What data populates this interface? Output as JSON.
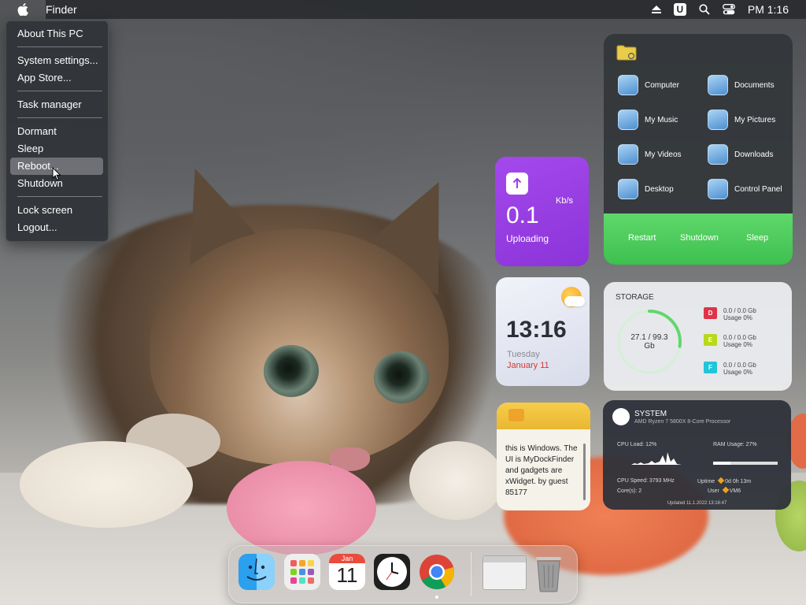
{
  "menubar": {
    "app_name": "Finder",
    "time": "PM 1:16",
    "u_label": "U"
  },
  "apple_menu": {
    "items": [
      {
        "label": "About This PC"
      },
      {
        "label": "System settings..."
      },
      {
        "label": "App Store..."
      },
      {
        "label": "Task manager"
      },
      {
        "label": "Dormant"
      },
      {
        "label": "Sleep"
      },
      {
        "label": "Reboot..."
      },
      {
        "label": "Shutdown"
      },
      {
        "label": "Lock screen"
      },
      {
        "label": "Logout..."
      }
    ],
    "highlighted": "Reboot..."
  },
  "upload_widget": {
    "value": "0.1",
    "unit": "Kb/s",
    "label": "Uploading"
  },
  "folder_widget": {
    "items": [
      {
        "label": "Computer"
      },
      {
        "label": "Documents"
      },
      {
        "label": "My Music"
      },
      {
        "label": "My Pictures"
      },
      {
        "label": "My Videos"
      },
      {
        "label": "Downloads"
      },
      {
        "label": "Desktop"
      },
      {
        "label": "Control Panel"
      }
    ],
    "power": {
      "restart": "Restart",
      "shutdown": "Shutdown",
      "sleep": "Sleep"
    }
  },
  "clock_widget": {
    "time": "13:16",
    "day": "Tuesday",
    "date": "January 11"
  },
  "storage_widget": {
    "title": "STORAGE",
    "ring_text_1": "27.1 / 99.3",
    "ring_text_2": "Gb",
    "ring_fraction": 0.273,
    "drives": [
      {
        "letter": "D",
        "color": "#e0334a",
        "size": "0.0 / 0.0 Gb",
        "usage": "Usage 0%"
      },
      {
        "letter": "E",
        "color": "#b8d81a",
        "size": "0.0 / 0.0 Gb",
        "usage": "Usage 0%"
      },
      {
        "letter": "F",
        "color": "#22c5d8",
        "size": "0.0 / 0.0 Gb",
        "usage": "Usage 0%"
      }
    ]
  },
  "note_widget": {
    "text": "this is Windows. The UI is MyDockFinder and gadgets are xWidget. by guest 85177"
  },
  "system_widget": {
    "title": "SYSTEM",
    "processor": "AMD Ryzen 7 5800X 8-Core Processor",
    "cpu_load": "CPU Load: 12%",
    "ram_usage": "RAM Usage: 27%",
    "ram_fraction": 0.27,
    "cpu_speed": "CPU Speed: 3793 MHz",
    "cores": "Core(s): 2",
    "uptime_label": "Uptime",
    "uptime_value": "0d 0h 13m",
    "user_label": "User",
    "user_value": "VM6",
    "updated": "Updated 11.1.2022 13:16:47"
  },
  "dock": {
    "calendar_month": "Jan",
    "calendar_day": "11"
  },
  "colors": {
    "upload_bg": "#9b3fe6",
    "power_bar": "#47c957",
    "date_red": "#d6362f",
    "ring_green": "#5fd86b"
  }
}
